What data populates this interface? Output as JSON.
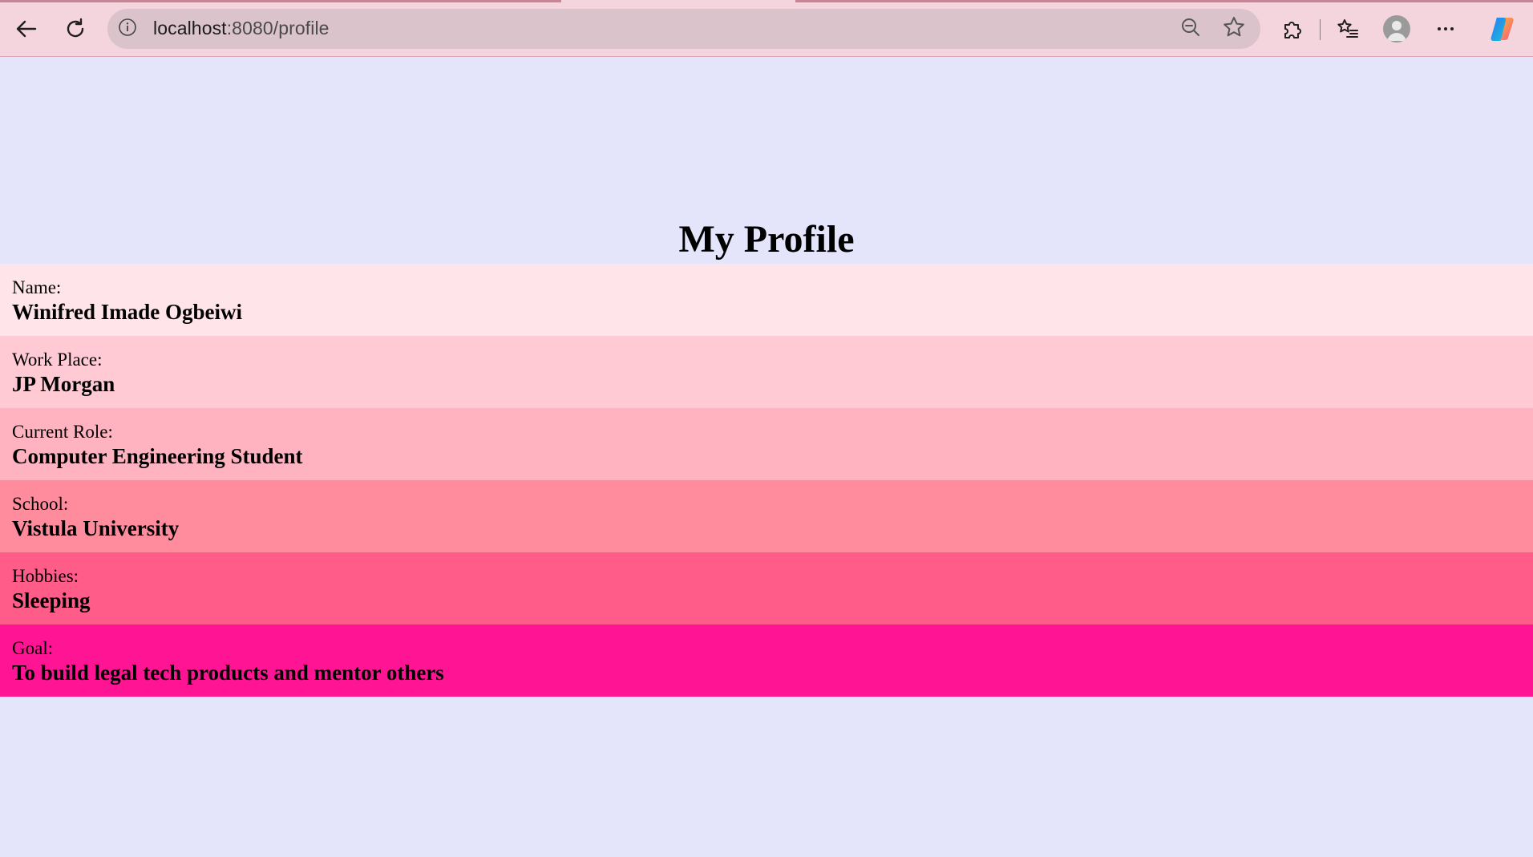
{
  "browser": {
    "url_host": "localhost",
    "url_rest": ":8080/profile",
    "icons": {
      "back": "back-arrow-icon",
      "reload": "reload-icon",
      "site_info": "info-icon",
      "zoom": "zoom-out-icon",
      "favorite": "star-icon",
      "extensions": "puzzle-icon",
      "favorites": "favorites-list-icon",
      "profile": "avatar-icon",
      "menu": "more-icon",
      "copilot": "copilot-icon"
    }
  },
  "page": {
    "title": "My Profile",
    "background": "#e4e4fa",
    "rows": [
      {
        "label": "Name:",
        "value": "Winifred Imade Ogbeiwi",
        "color": "#ffe4e9"
      },
      {
        "label": "Work Place:",
        "value": "JP Morgan",
        "color": "#ffcad4"
      },
      {
        "label": "Current Role:",
        "value": "Computer Engineering Student",
        "color": "#ffb3c1"
      },
      {
        "label": "School:",
        "value": "Vistula University",
        "color": "#ff8c9d"
      },
      {
        "label": "Hobbies:",
        "value": "Sleeping",
        "color": "#ff5c8a"
      },
      {
        "label": "Goal:",
        "value": "To build legal tech products and mentor others",
        "color": "#ff1493"
      }
    ]
  }
}
